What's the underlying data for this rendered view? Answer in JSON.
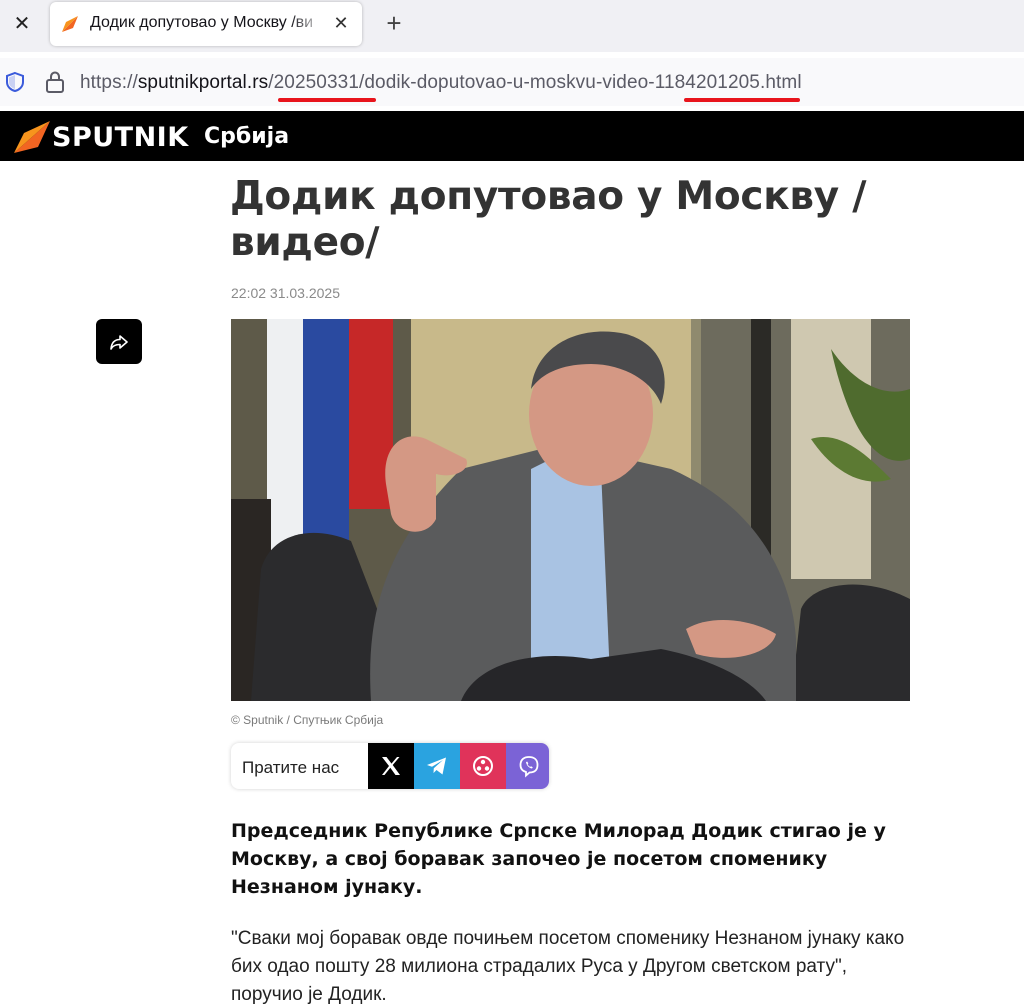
{
  "browser": {
    "tab": {
      "title": "Додик допутовао у Москву /ви"
    },
    "url": {
      "scheme": "https://",
      "domain": "sputnikportal.rs",
      "path_date": "/20250331",
      "path_mid": "/dodik-doputovao-u-moskvu-video-",
      "path_id": "1184201205",
      "path_ext": ".html"
    },
    "annotation_color": "#e8141c"
  },
  "site": {
    "logo_text": "SPUTNIK",
    "edition": "Србија",
    "brand_color": "#f26522"
  },
  "article": {
    "headline": "Додик допутовао у Москву /видео/",
    "datetime": "22:02 31.03.2025",
    "photo_credit": "© Sputnik / Спутњик Србија",
    "follow_label": "Пратите нас",
    "social": [
      {
        "icon": "x-icon",
        "color": "#000000"
      },
      {
        "icon": "telegram-icon",
        "color": "#2aa3e0"
      },
      {
        "icon": "vk-icon",
        "color": "#e0335a"
      },
      {
        "icon": "viber-icon",
        "color": "#7b63d6"
      }
    ],
    "lead": "Председник Републике Српске Милорад Додик стигао је у Москву, а свој боравак започео је посетом споменику Незнаном јунаку.",
    "body": "\"Сваки мој боравак овде почињем посетом споменику Незнаном јунаку како бих одао пошту 28 милиона страдалих Руса у Другом светском рату\", поручио је Додик."
  }
}
